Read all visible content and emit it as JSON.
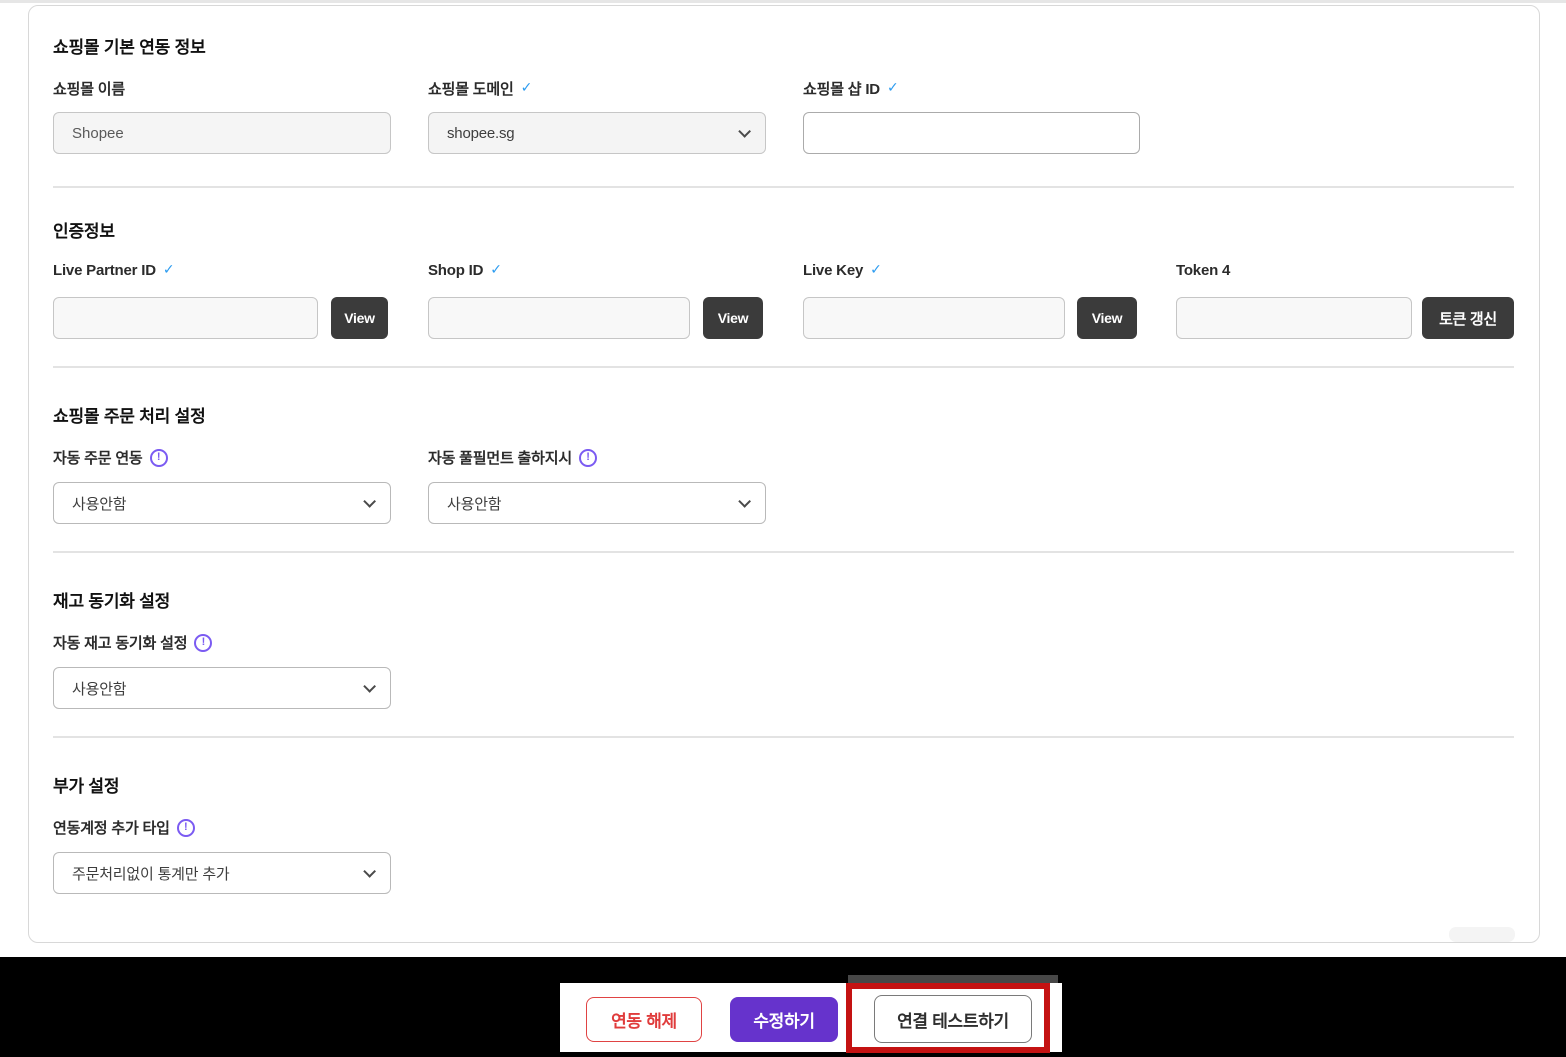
{
  "icons": {
    "check": "✓",
    "info": "!"
  },
  "sections": {
    "basic": {
      "title": "쇼핑몰 기본 연동 정보",
      "name_label": "쇼핑몰 이름",
      "name_value": "Shopee",
      "domain_label": "쇼핑몰 도메인",
      "domain_value": "shopee.sg",
      "shop_id_label": "쇼핑몰 샵 ID",
      "shop_id_value": ""
    },
    "auth": {
      "title": "인증정보",
      "live_partner_id_label": "Live Partner ID",
      "live_partner_id_value": "",
      "shop_id_label": "Shop ID",
      "shop_id_value": "",
      "live_key_label": "Live Key",
      "live_key_value": "",
      "token_label": "Token 4",
      "token_value": "",
      "view_button": "View",
      "token_refresh_button": "토큰 갱신"
    },
    "order": {
      "title": "쇼핑몰 주문 처리 설정",
      "auto_order_label": "자동 주문 연동",
      "auto_order_value": "사용안함",
      "auto_fulfillment_label": "자동 풀필먼트 출하지시",
      "auto_fulfillment_value": "사용안함"
    },
    "inventory": {
      "title": "재고 동기화 설정",
      "auto_sync_label": "자동 재고 동기화 설정",
      "auto_sync_value": "사용안함"
    },
    "extra": {
      "title": "부가 설정",
      "account_type_label": "연동계정 추가 타입",
      "account_type_value": "주문처리없이 통계만 추가"
    }
  },
  "footer": {
    "disconnect_button": "연동 해제",
    "save_button": "수정하기",
    "test_button": "연결 테스트하기"
  },
  "colors": {
    "accent_purple": "#6633cc",
    "danger_red": "#e03c3c",
    "highlight_red": "#c41212",
    "check_blue": "#2d9cf0",
    "info_purple": "#7b5bf2",
    "dark_button": "#3b3b3b"
  }
}
